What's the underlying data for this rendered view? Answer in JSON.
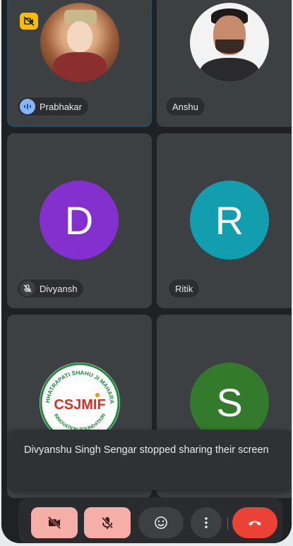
{
  "participants": [
    {
      "name": "Prabhakar",
      "speaking": true,
      "camera_off_badge": true
    },
    {
      "name": "Anshu"
    },
    {
      "name": "Divyansh",
      "initial": "D",
      "muted": true,
      "avatar_color": "#8430ce"
    },
    {
      "name": "Ritik",
      "initial": "R",
      "avatar_color": "#129eaf"
    },
    {
      "name": "",
      "logo_text_top": "CHHATRAPATI SHAHU JI MAHARAJ",
      "logo_text_center": "CSJMIF",
      "logo_text_bottom": "INNOVATION FOUNDATION"
    },
    {
      "name": "",
      "initial": "S",
      "avatar_color": "#337a2c"
    }
  ],
  "toast": {
    "message": "Divyanshu Singh Sengar stopped sharing their screen"
  },
  "controls": {
    "camera": "camera-off-icon",
    "mic": "mic-off-icon",
    "reactions": "emoji-icon",
    "more": "more-vertical-icon",
    "leave": "end-call-icon"
  },
  "colors": {
    "background": "#202124",
    "tile": "#3c4043",
    "end_call": "#ea4335",
    "control_off": "#f6aea9",
    "speaking": "#8ab4f8",
    "badge": "#fbbc04"
  }
}
